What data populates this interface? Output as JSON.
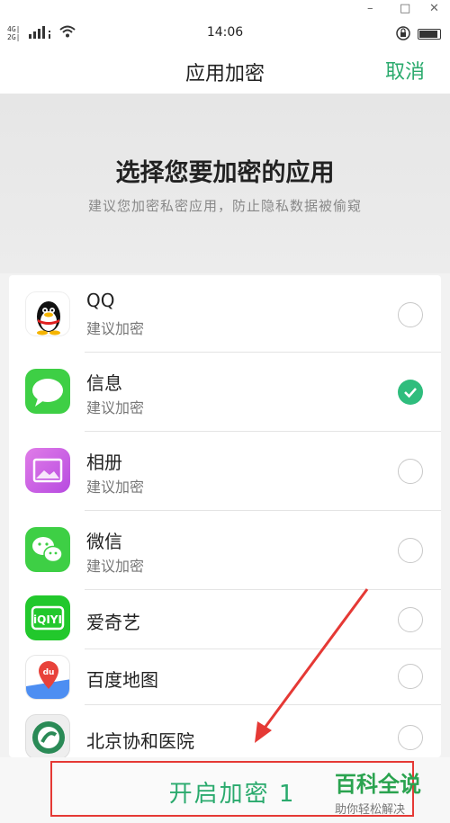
{
  "window": {
    "minimize": "–",
    "maximize": "□",
    "close": "✕"
  },
  "status": {
    "signal_line1": "4G|",
    "signal_line2": "2G|",
    "time": "14:06"
  },
  "header": {
    "title": "应用加密",
    "cancel": "取消"
  },
  "intro": {
    "heading": "选择您要加密的应用",
    "subtitle": "建议您加密私密应用，防止隐私数据被偷窥"
  },
  "apps": [
    {
      "name": "QQ",
      "sub": "建议加密",
      "icon": "qq-icon",
      "checked": false
    },
    {
      "name": "信息",
      "sub": "建议加密",
      "icon": "messages-icon",
      "checked": true
    },
    {
      "name": "相册",
      "sub": "建议加密",
      "icon": "gallery-icon",
      "checked": false
    },
    {
      "name": "微信",
      "sub": "建议加密",
      "icon": "wechat-icon",
      "checked": false
    },
    {
      "name": "爱奇艺",
      "sub": "",
      "icon": "iqiyi-icon",
      "checked": false
    },
    {
      "name": "百度地图",
      "sub": "",
      "icon": "baidu-map-icon",
      "checked": false
    },
    {
      "name": "北京协和医院",
      "sub": "",
      "icon": "hospital-icon",
      "checked": false
    }
  ],
  "bottom": {
    "start_label": "开启加密 1"
  },
  "watermark": {
    "main": "百科全说",
    "sub": "助你轻松解决"
  },
  "colors": {
    "accent": "#2aaa6d",
    "check": "#2fbd7d",
    "highlight": "#e53935"
  }
}
